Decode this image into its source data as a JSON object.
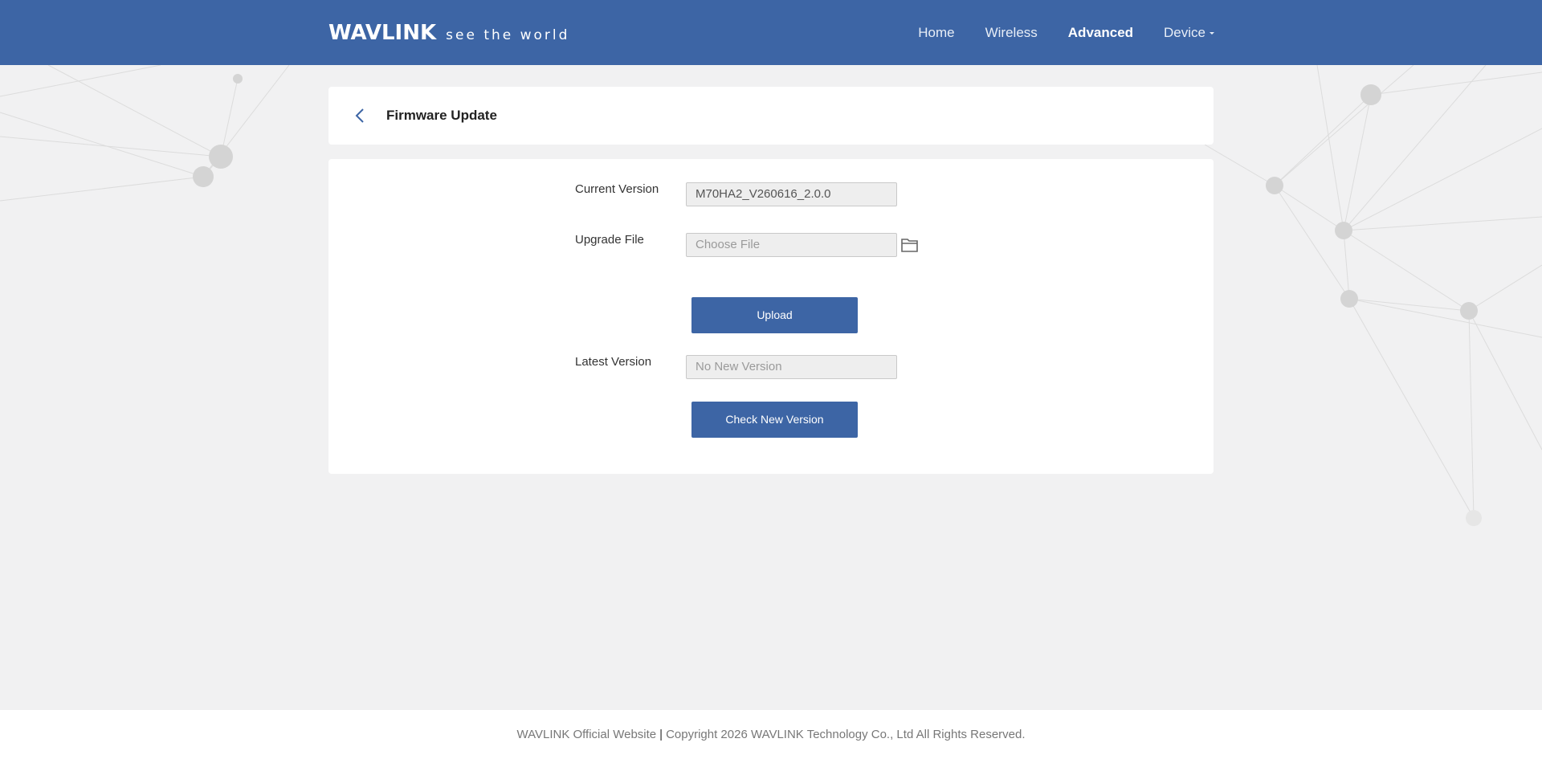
{
  "header": {
    "brand": "WAVLINK",
    "slogan": "see the world",
    "nav": [
      {
        "label": "Home"
      },
      {
        "label": "Wireless"
      },
      {
        "label": "Advanced"
      },
      {
        "label": "Device"
      }
    ],
    "active_nav": "Advanced",
    "background_color": "#3d65a5"
  },
  "page": {
    "title": "Firmware Update",
    "back_icon": "chevron-left-icon"
  },
  "form": {
    "current_version_label": "Current Version",
    "current_version_value": "M70HA2_V260616_2.0.0",
    "upgrade_file_label": "Upgrade File",
    "upgrade_file_placeholder": "Choose File",
    "folder_icon": "folder-icon",
    "upload_button": "Upload",
    "latest_version_label": "Latest Version",
    "latest_version_value": "No New Version",
    "check_button": "Check New Version"
  },
  "footer": {
    "website_link": "WAVLINK Official Website",
    "separator": "|",
    "copyright": "Copyright 2026 WAVLINK Technology Co., Ltd All Rights Reserved."
  },
  "colors": {
    "accent": "#3d65a5",
    "page_background": "#f1f1f2",
    "card_background": "#ffffff"
  }
}
